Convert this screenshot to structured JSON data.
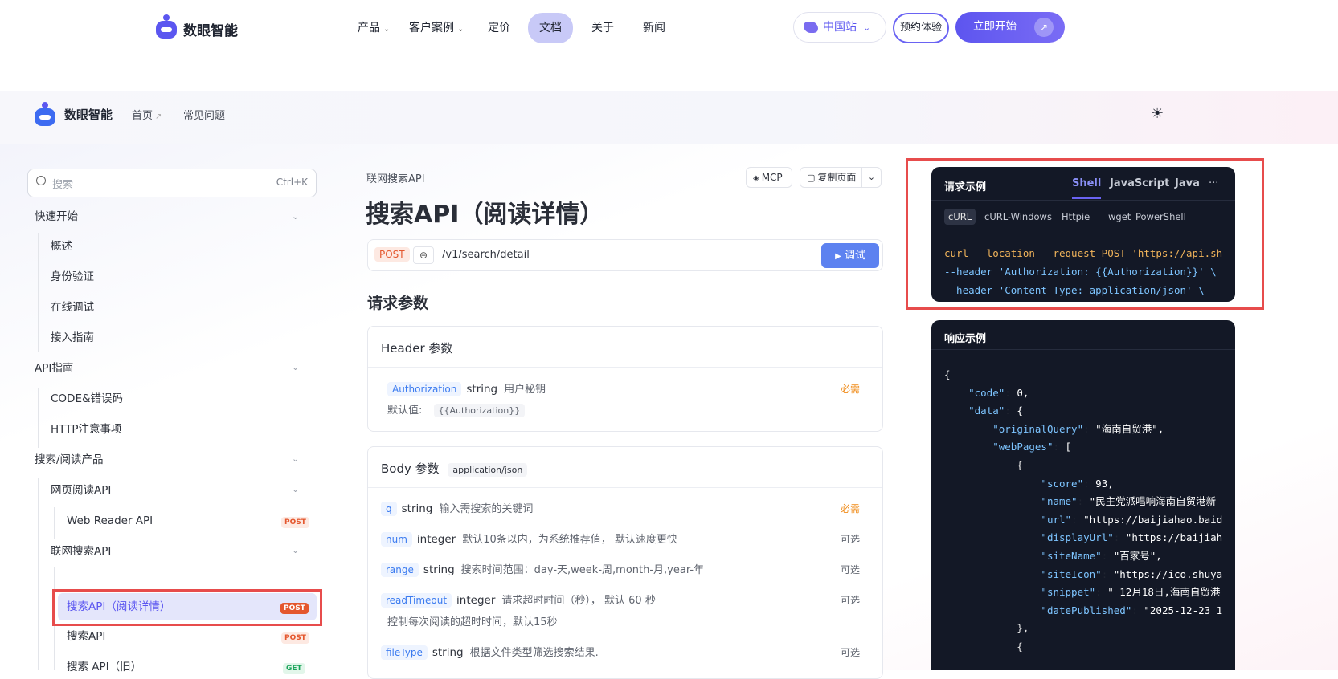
{
  "topnav": {
    "brand": "数眼智能",
    "items": [
      {
        "label": "产品",
        "caret": "⌄"
      },
      {
        "label": "客户案例",
        "caret": "⌄"
      },
      {
        "label": "定价"
      },
      {
        "label": "文档"
      },
      {
        "label": "关于"
      },
      {
        "label": "新闻"
      }
    ],
    "region": "中国站",
    "demo": "预约体验",
    "start": "立即开始"
  },
  "docsbar": {
    "brand": "数眼智能",
    "home": "首页",
    "faq": "常见问题"
  },
  "sidebar": {
    "search_placeholder": "搜索",
    "search_shortcut": "Ctrl+K",
    "sections": [
      {
        "label": "快速开始"
      },
      {
        "label": "概述"
      },
      {
        "label": "身份验证"
      },
      {
        "label": "在线调试"
      },
      {
        "label": "接入指南"
      },
      {
        "label": "API指南"
      },
      {
        "label": "CODE&错误码"
      },
      {
        "label": "HTTP注意事项"
      },
      {
        "label": "搜索/阅读产品"
      },
      {
        "label": "网页阅读API"
      },
      {
        "label": "Web Reader API",
        "badge": "POST"
      },
      {
        "label": "联网搜索API"
      },
      {
        "label": "搜索API（阅读详情）",
        "badge": "POST"
      },
      {
        "label": "搜索API",
        "badge": "POST"
      },
      {
        "label": "搜索 API（旧）",
        "badge": "GET"
      }
    ]
  },
  "main": {
    "breadcrumb": "联网搜索API",
    "mcp": "MCP",
    "copy_page": "复制页面",
    "title": "搜索API（阅读详情）",
    "method": "POST",
    "path": "/v1/search/detail",
    "debug": "调试",
    "section_title": "请求参数",
    "header_card": {
      "title": "Header 参数",
      "param": "Authorization",
      "type": "string",
      "desc": "用户秘钥",
      "required": "必需",
      "default_label": "默认值:",
      "default_value": "{{Authorization}}"
    },
    "body_card": {
      "title": "Body 参数",
      "content_type": "application/json",
      "params": [
        {
          "name": "q",
          "type": "string",
          "desc": "输入需搜索的关键词",
          "flag": "必需"
        },
        {
          "name": "num",
          "type": "integer",
          "desc": "默认10条以内，为系统推荐值， 默认速度更快",
          "flag": "可选"
        },
        {
          "name": "range",
          "type": "string",
          "desc": "搜索时间范围：day-天,week-周,month-月,year-年",
          "flag": "可选"
        },
        {
          "name": "readTimeout",
          "type": "integer",
          "desc": "请求超时时间（秒）， 默认 60 秒",
          "flag": "可选",
          "extra": "控制每次阅读的超时时间，默认15秒"
        },
        {
          "name": "fileType",
          "type": "string",
          "desc": "根据文件类型筛选搜索结果.",
          "flag": "可选"
        }
      ]
    }
  },
  "request_panel": {
    "title": "请求示例",
    "tabs": [
      "Shell",
      "JavaScript",
      "Java",
      "···"
    ],
    "subtabs": [
      "cURL",
      "cURL-Windows",
      "Httpie",
      "wget",
      "PowerShell"
    ],
    "lines": [
      "curl --location --request POST 'https://api.sh",
      "--header 'Authorization: {{Authorization}}' \\",
      "--header 'Content-Type: application/json' \\"
    ]
  },
  "response_panel": {
    "title": "响应示例",
    "lines": [
      "{",
      "    \"code\": 0,",
      "    \"data\": {",
      "        \"originalQuery\": \"海南自贸港\",",
      "        \"webPages\": [",
      "            {",
      "                \"score\": 93,",
      "                \"name\": \"民主党派唱响海南自贸港新",
      "                \"url\": \"https://baijiahao.baid",
      "                \"displayUrl\": \"https://baijiah",
      "                \"siteName\": \"百家号\",",
      "                \"siteIcon\": \"https://ico.shuya",
      "                \"snippet\": \" 12月18日,海南自贸港",
      "                \"datePublished\": \"2025-12-23 1",
      "            },",
      "            {"
    ]
  },
  "colors": {
    "accent": "#5b56f0",
    "primary_button": "#6a63f3",
    "highlight_red": "#e74c4c",
    "code_bg": "#131826"
  }
}
